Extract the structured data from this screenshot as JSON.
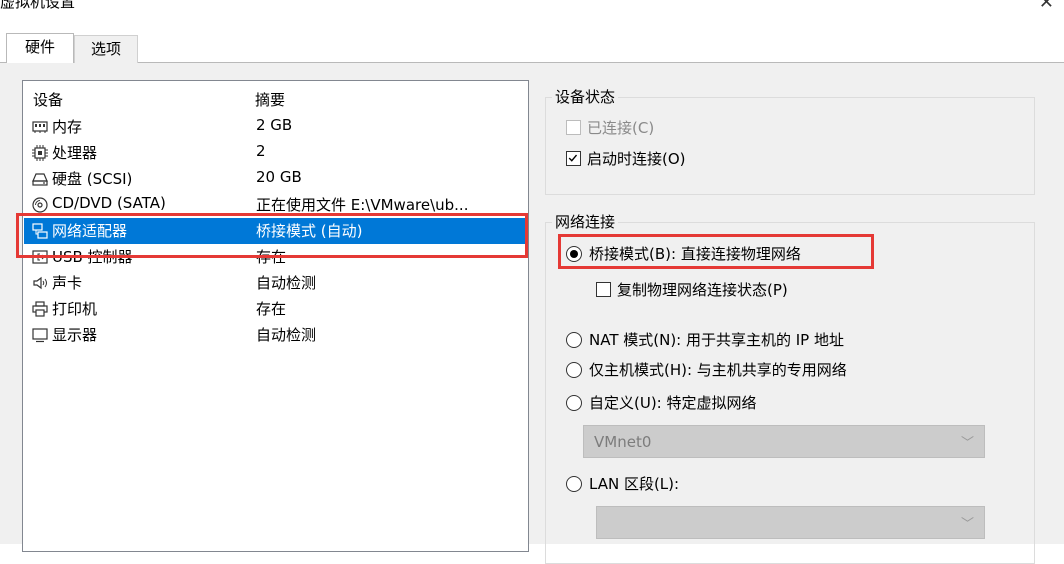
{
  "window": {
    "title": "虚拟机设置",
    "close_glyph": "✕"
  },
  "tabs": [
    {
      "label": "硬件"
    },
    {
      "label": "选项"
    }
  ],
  "device_list": {
    "header": {
      "device": "设备",
      "summary": "摘要"
    },
    "rows": [
      {
        "name": "内存",
        "summary": "2 GB",
        "icon": "memory-icon"
      },
      {
        "name": "处理器",
        "summary": "2",
        "icon": "processor-icon"
      },
      {
        "name": "硬盘 (SCSI)",
        "summary": "20 GB",
        "icon": "harddisk-icon"
      },
      {
        "name": "CD/DVD (SATA)",
        "summary": "正在使用文件 E:\\VMware\\ub...",
        "icon": "cd-dvd-icon"
      },
      {
        "name": "网络适配器",
        "summary": "桥接模式 (自动)",
        "icon": "network-adapter-icon",
        "selected": true
      },
      {
        "name": "USB 控制器",
        "summary": "存在",
        "icon": "usb-icon"
      },
      {
        "name": "声卡",
        "summary": "自动检测",
        "icon": "sound-icon"
      },
      {
        "name": "打印机",
        "summary": "存在",
        "icon": "printer-icon"
      },
      {
        "name": "显示器",
        "summary": "自动检测",
        "icon": "display-icon"
      }
    ]
  },
  "device_status": {
    "title": "设备状态",
    "connected": {
      "label": "已连接(C)",
      "checked": false,
      "enabled": false
    },
    "connect_at_power_on": {
      "label": "启动时连接(O)",
      "checked": true
    }
  },
  "network_connection": {
    "title": "网络连接",
    "bridged": {
      "label": "桥接模式(B): 直接连接物理网络",
      "selected": true
    },
    "replicate": {
      "label": "复制物理网络连接状态(P)",
      "checked": false
    },
    "nat": {
      "label": "NAT 模式(N): 用于共享主机的 IP 地址",
      "selected": false
    },
    "host_only": {
      "label": "仅主机模式(H): 与主机共享的专用网络",
      "selected": false
    },
    "custom": {
      "label": "自定义(U): 特定虚拟网络",
      "selected": false
    },
    "custom_select_value": "VMnet0",
    "lan_segment": {
      "label": "LAN 区段(L):",
      "selected": false
    },
    "lan_select_value": ""
  },
  "colors": {
    "selection": "#0078d7",
    "highlight_frame": "#e53935",
    "dialog_bg": "#f0f0f0"
  }
}
